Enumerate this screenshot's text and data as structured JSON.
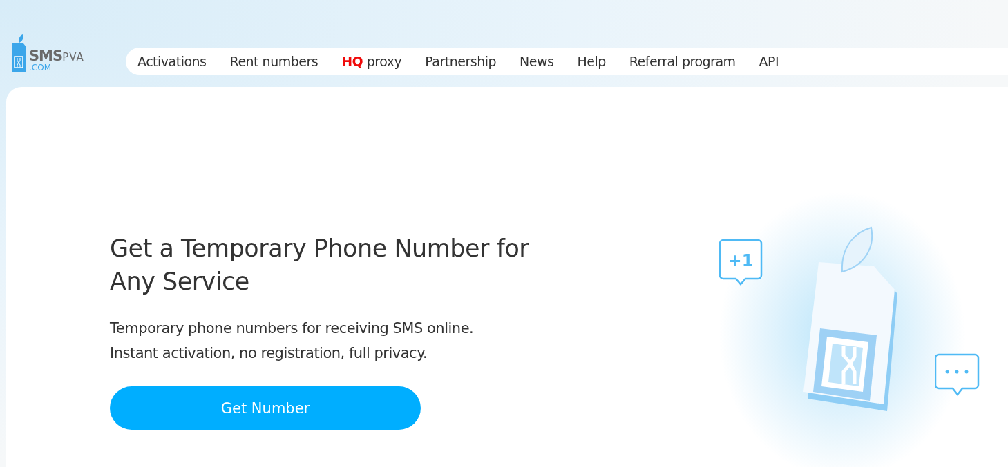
{
  "logo": {
    "name": "SMS",
    "suffix": "PVA",
    "domain": ".COM"
  },
  "nav": [
    {
      "label": "Activations"
    },
    {
      "label": "Rent numbers"
    },
    {
      "highlight": "HQ",
      "label": "proxy"
    },
    {
      "label": "Partnership"
    },
    {
      "label": "News"
    },
    {
      "label": "Help"
    },
    {
      "label": "Referral program"
    },
    {
      "label": "API"
    }
  ],
  "hero": {
    "title": "Get a Temporary Phone Number for Any Service",
    "subtitle": "Temporary phone numbers for receiving SMS online.\nInstant activation, no registration, full privacy.",
    "button": "Get Number",
    "bubble": "+1"
  }
}
